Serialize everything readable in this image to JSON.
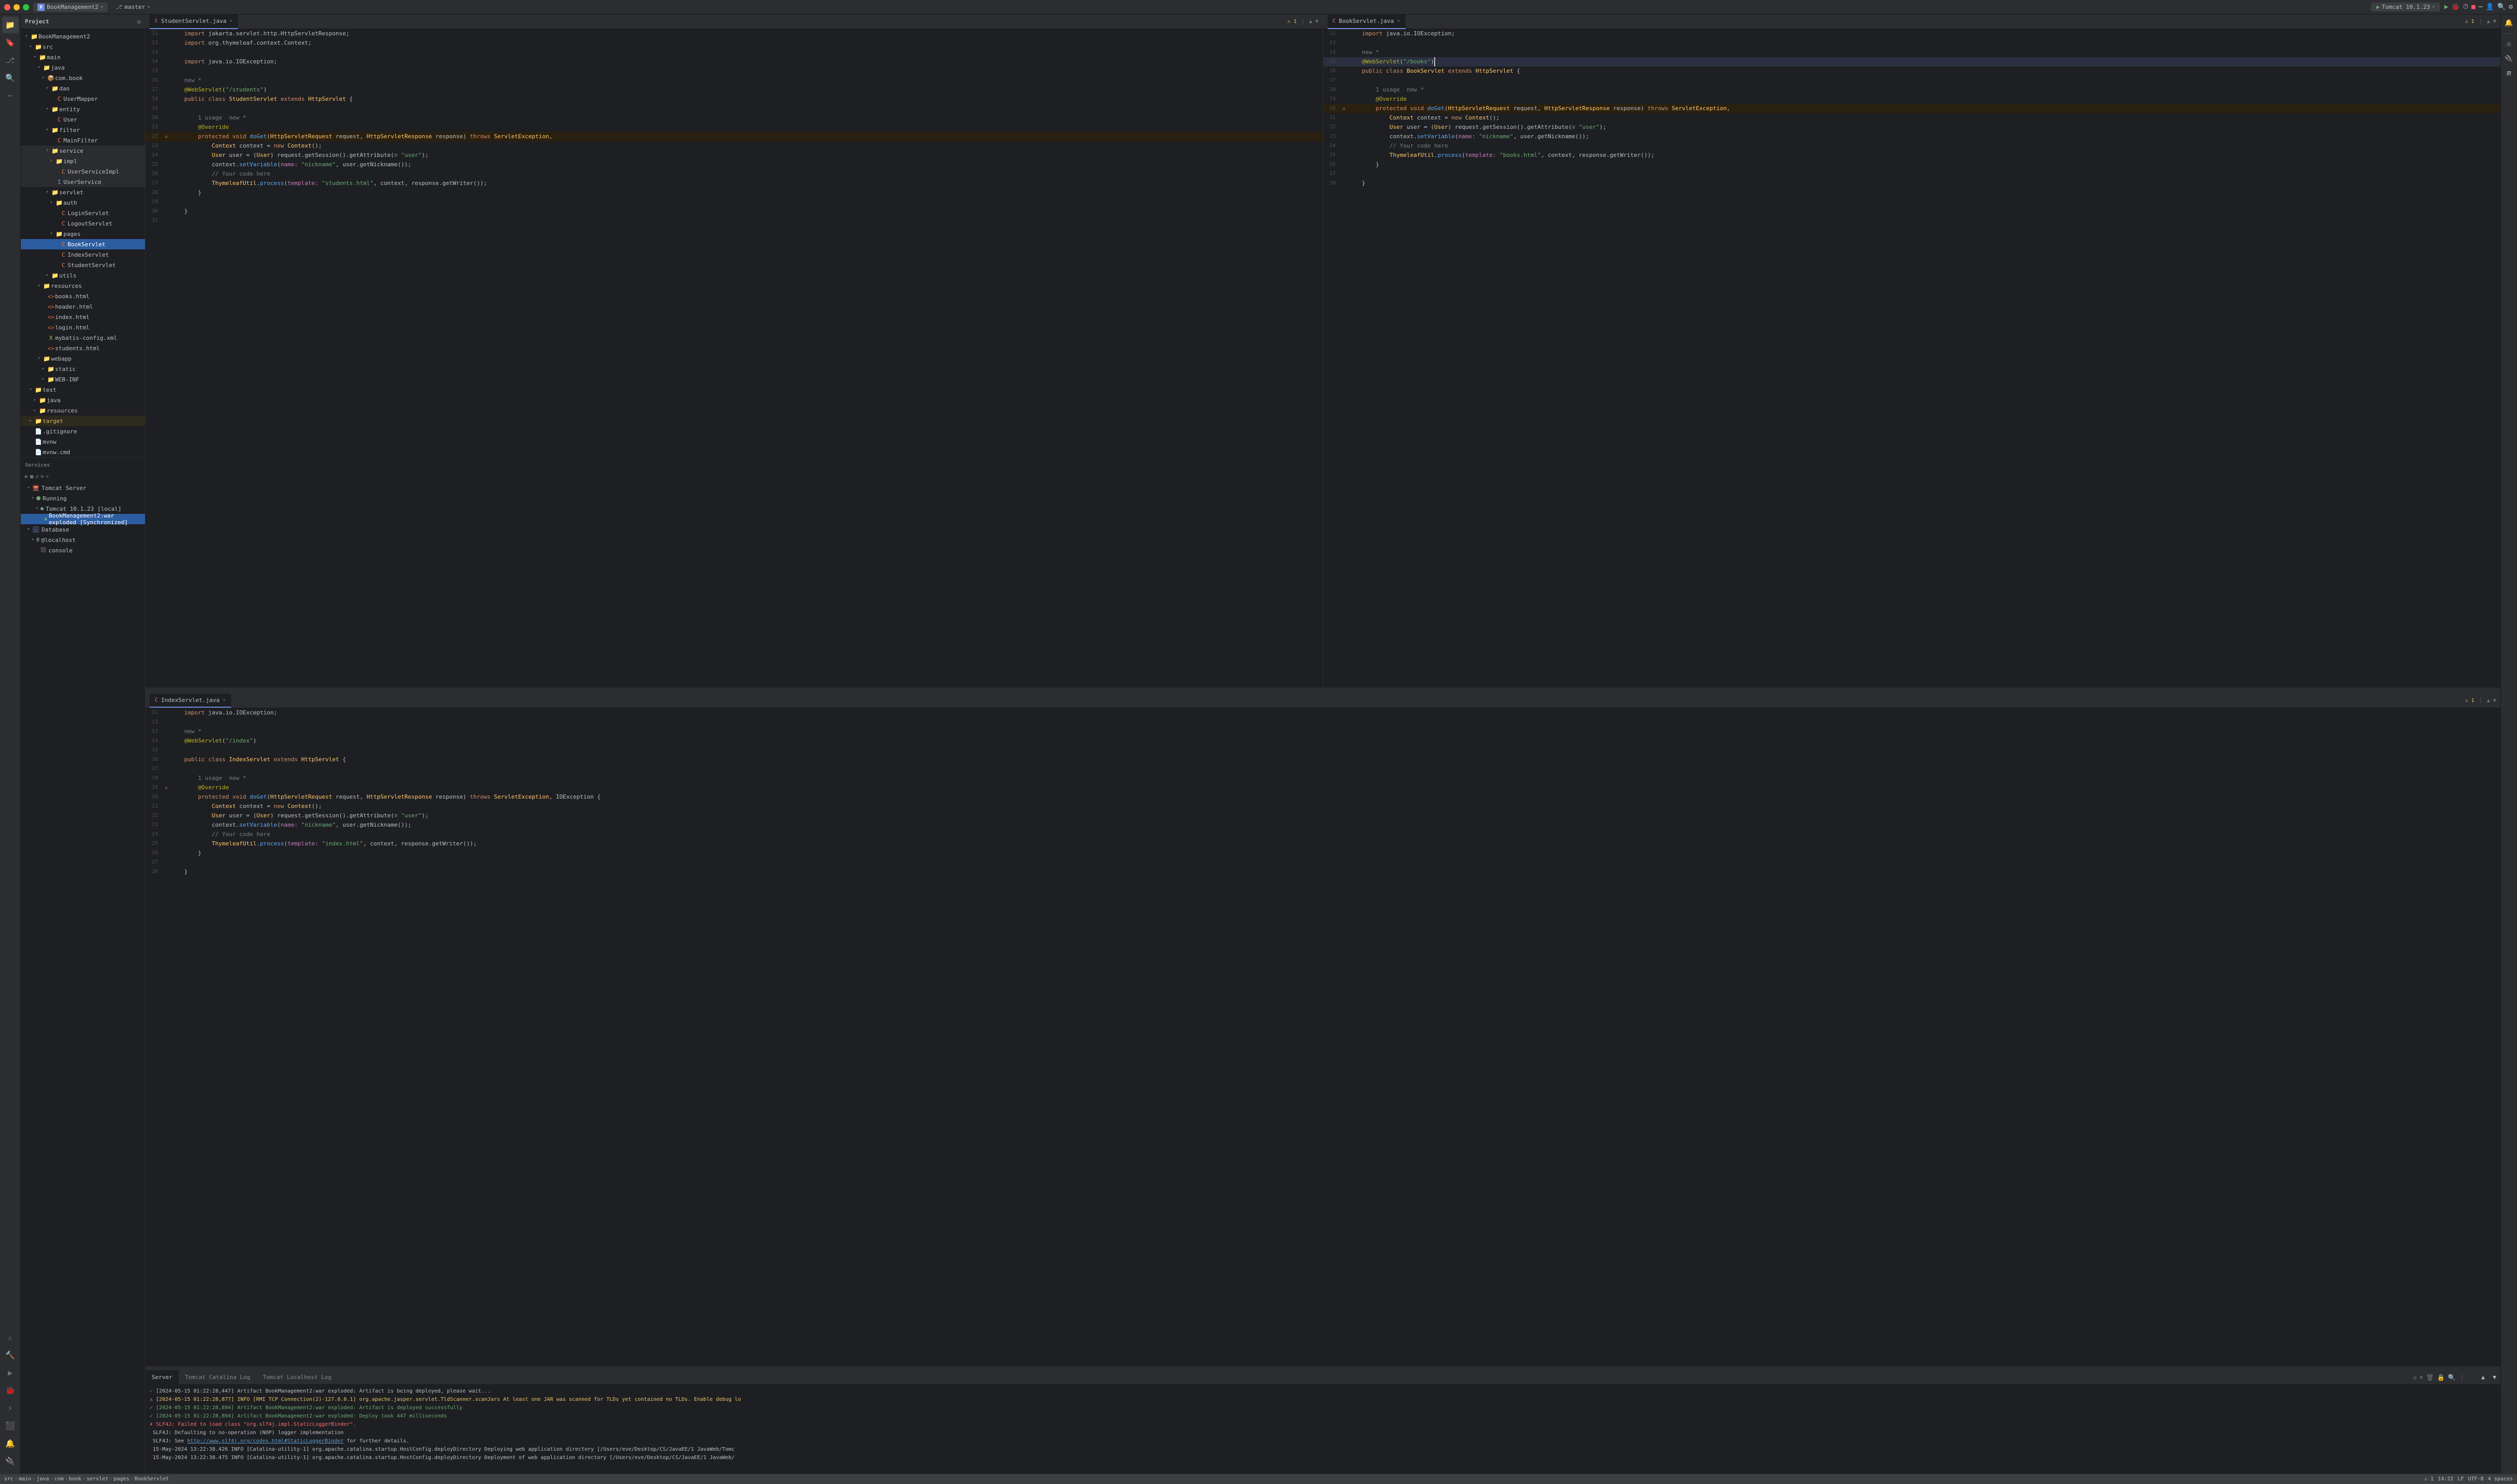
{
  "app": {
    "title": "BookManagement2",
    "branch": "master",
    "run_config": "Tomcat 10.1.23"
  },
  "titlebar": {
    "project_label": "BookManagement2",
    "branch_label": "master",
    "run_label": "Tomcat 10.1.23"
  },
  "panel": {
    "title": "Project"
  },
  "project_tree": {
    "items": [
      {
        "id": "bm2",
        "label": "BookManagement2",
        "type": "root",
        "indent": 0,
        "expanded": true,
        "icon": "folder"
      },
      {
        "id": "src",
        "label": "src",
        "type": "folder",
        "indent": 1,
        "expanded": false,
        "icon": "folder"
      },
      {
        "id": "main",
        "label": "main",
        "type": "folder",
        "indent": 2,
        "expanded": true,
        "icon": "folder"
      },
      {
        "id": "java-main",
        "label": "java",
        "type": "folder",
        "indent": 3,
        "expanded": true,
        "icon": "folder"
      },
      {
        "id": "com-book",
        "label": "com.book",
        "type": "package",
        "indent": 4,
        "expanded": true,
        "icon": "package"
      },
      {
        "id": "dao",
        "label": "dao",
        "type": "folder",
        "indent": 5,
        "expanded": true,
        "icon": "folder"
      },
      {
        "id": "usermapper",
        "label": "UserMapper",
        "type": "java",
        "indent": 6,
        "icon": "java"
      },
      {
        "id": "entity",
        "label": "entity",
        "type": "folder",
        "indent": 5,
        "expanded": true,
        "icon": "folder"
      },
      {
        "id": "user",
        "label": "User",
        "type": "java",
        "indent": 6,
        "icon": "java"
      },
      {
        "id": "filter",
        "label": "filter",
        "type": "folder",
        "indent": 5,
        "expanded": true,
        "icon": "folder"
      },
      {
        "id": "mainfilter",
        "label": "MainFilter",
        "type": "java",
        "indent": 6,
        "icon": "java"
      },
      {
        "id": "service",
        "label": "service",
        "type": "folder",
        "indent": 5,
        "expanded": true,
        "icon": "folder"
      },
      {
        "id": "impl",
        "label": "impl",
        "type": "folder",
        "indent": 6,
        "expanded": true,
        "icon": "folder"
      },
      {
        "id": "userserviceimpl",
        "label": "UserServiceImpl",
        "type": "java",
        "indent": 7,
        "icon": "java"
      },
      {
        "id": "userservice",
        "label": "UserService",
        "type": "java",
        "indent": 6,
        "icon": "java"
      },
      {
        "id": "servlet",
        "label": "servlet",
        "type": "folder",
        "indent": 5,
        "expanded": true,
        "icon": "folder"
      },
      {
        "id": "auth",
        "label": "auth",
        "type": "folder",
        "indent": 6,
        "expanded": true,
        "icon": "folder"
      },
      {
        "id": "loginservlet",
        "label": "LoginServlet",
        "type": "java",
        "indent": 7,
        "icon": "java"
      },
      {
        "id": "logoutservlet",
        "label": "LogoutServlet",
        "type": "java",
        "indent": 7,
        "icon": "java"
      },
      {
        "id": "pages",
        "label": "pages",
        "type": "folder",
        "indent": 6,
        "expanded": true,
        "icon": "folder"
      },
      {
        "id": "bookservlet",
        "label": "BookServlet",
        "type": "java",
        "indent": 7,
        "icon": "java",
        "selected": true
      },
      {
        "id": "indexservlet",
        "label": "IndexServlet",
        "type": "java",
        "indent": 7,
        "icon": "java"
      },
      {
        "id": "studentservlet",
        "label": "StudentServlet",
        "type": "java",
        "indent": 7,
        "icon": "java"
      },
      {
        "id": "utils",
        "label": "utils",
        "type": "folder",
        "indent": 5,
        "expanded": false,
        "icon": "folder"
      },
      {
        "id": "resources",
        "label": "resources",
        "type": "folder",
        "indent": 3,
        "expanded": true,
        "icon": "folder"
      },
      {
        "id": "books-html",
        "label": "books.html",
        "type": "html",
        "indent": 4,
        "icon": "html"
      },
      {
        "id": "header-html",
        "label": "header.html",
        "type": "html",
        "indent": 4,
        "icon": "html"
      },
      {
        "id": "index-html",
        "label": "index.html",
        "type": "html",
        "indent": 4,
        "icon": "html"
      },
      {
        "id": "login-html",
        "label": "login.html",
        "type": "html",
        "indent": 4,
        "icon": "html"
      },
      {
        "id": "mybatis-config",
        "label": "mybatis-config.xml",
        "type": "xml",
        "indent": 4,
        "icon": "xml"
      },
      {
        "id": "students-html",
        "label": "students.html",
        "type": "html",
        "indent": 4,
        "icon": "html"
      },
      {
        "id": "webapp",
        "label": "webapp",
        "type": "folder",
        "indent": 3,
        "expanded": true,
        "icon": "folder"
      },
      {
        "id": "static",
        "label": "static",
        "type": "folder",
        "indent": 4,
        "expanded": false,
        "icon": "folder"
      },
      {
        "id": "web-inf",
        "label": "WEB-INF",
        "type": "folder",
        "indent": 4,
        "expanded": false,
        "icon": "folder"
      },
      {
        "id": "test",
        "label": "test",
        "type": "folder",
        "indent": 1,
        "expanded": true,
        "icon": "folder"
      },
      {
        "id": "java-test",
        "label": "java",
        "type": "folder",
        "indent": 2,
        "expanded": false,
        "icon": "folder"
      },
      {
        "id": "resources-test",
        "label": "resources",
        "type": "folder",
        "indent": 2,
        "expanded": false,
        "icon": "folder"
      },
      {
        "id": "target",
        "label": "target",
        "type": "folder",
        "indent": 1,
        "expanded": false,
        "icon": "folder",
        "highlight": true
      },
      {
        "id": "gitignore",
        "label": ".gitignore",
        "type": "file",
        "indent": 1,
        "icon": "file"
      },
      {
        "id": "mvnw",
        "label": "mvnw",
        "type": "file",
        "indent": 1,
        "icon": "file"
      },
      {
        "id": "mvnw-cmd",
        "label": "mvnw.cmd",
        "type": "file",
        "indent": 1,
        "icon": "file"
      }
    ]
  },
  "services": {
    "header": "Services",
    "items": [
      {
        "id": "tomcat-server",
        "label": "Tomcat Server",
        "type": "server",
        "indent": 0,
        "expanded": true
      },
      {
        "id": "running",
        "label": "Running",
        "type": "status",
        "indent": 1,
        "expanded": true
      },
      {
        "id": "tomcat-local",
        "label": "Tomcat 10.1.23 [local]",
        "type": "instance",
        "indent": 2,
        "expanded": true
      },
      {
        "id": "bm2-war",
        "label": "BookManagement2:war exploded [Synchronized]",
        "type": "artifact",
        "indent": 3
      },
      {
        "id": "database",
        "label": "Database",
        "type": "database",
        "indent": 0,
        "expanded": true
      },
      {
        "id": "localhost",
        "label": "@localhost",
        "type": "db-conn",
        "indent": 1,
        "expanded": false
      },
      {
        "id": "console",
        "label": "console",
        "type": "db-console",
        "indent": 2
      }
    ]
  },
  "editors": {
    "left_pane": {
      "tab_label": "StudentServlet.java",
      "lines": [
        {
          "num": 11,
          "text": "    import jakarta.servlet.http.HttpServletResponse;",
          "gutter": ""
        },
        {
          "num": 12,
          "text": "    import org.thymeleaf.context.Context;",
          "gutter": ""
        },
        {
          "num": 13,
          "text": "",
          "gutter": ""
        },
        {
          "num": 14,
          "text": "    import java.io.IOException;",
          "gutter": ""
        },
        {
          "num": 15,
          "text": "",
          "gutter": ""
        },
        {
          "num": 16,
          "text": "    new *",
          "gutter": ""
        },
        {
          "num": 17,
          "text": "    @WebServlet(\"/students\")",
          "gutter": ""
        },
        {
          "num": 18,
          "text": "    public class StudentServlet extends HttpServlet {",
          "gutter": ""
        },
        {
          "num": 19,
          "text": "",
          "gutter": ""
        },
        {
          "num": 20,
          "text": "        1 usage  new *",
          "gutter": ""
        },
        {
          "num": 21,
          "text": "        @Override",
          "gutter": ""
        },
        {
          "num": 22,
          "text": "        protected void doGet(HttpServletRequest request, HttpServletResponse response) throws ServletException,",
          "gutter": "⚠"
        },
        {
          "num": 23,
          "text": "            Context context = new Context();",
          "gutter": ""
        },
        {
          "num": 24,
          "text": "            User user = (User) request.getSession().getAttribute(\"user\");",
          "gutter": ""
        },
        {
          "num": 25,
          "text": "            context.setVariable(name: \"nickname\", user.getNickname());",
          "gutter": ""
        },
        {
          "num": 26,
          "text": "            // Your code here",
          "gutter": ""
        },
        {
          "num": 27,
          "text": "            ThymeleafUtil.process(template: \"students.html\", context, response.getWriter());",
          "gutter": ""
        },
        {
          "num": 28,
          "text": "        }",
          "gutter": ""
        },
        {
          "num": 29,
          "text": "",
          "gutter": ""
        },
        {
          "num": 30,
          "text": "    }",
          "gutter": ""
        },
        {
          "num": 31,
          "text": "",
          "gutter": ""
        }
      ]
    },
    "right_pane": {
      "tab_label": "BookServlet.java",
      "lines": [
        {
          "num": 12,
          "text": "    import java.io.IOException;",
          "gutter": ""
        },
        {
          "num": 13,
          "text": "",
          "gutter": ""
        },
        {
          "num": 14,
          "text": "    new *",
          "gutter": ""
        },
        {
          "num": 15,
          "text": "    @WebServlet(\"/books\")",
          "gutter": "cursor"
        },
        {
          "num": 16,
          "text": "    public class BookServlet extends HttpServlet {",
          "gutter": ""
        },
        {
          "num": 17,
          "text": "",
          "gutter": ""
        },
        {
          "num": 18,
          "text": "        1 usage  new *",
          "gutter": ""
        },
        {
          "num": 19,
          "text": "        @Override",
          "gutter": ""
        },
        {
          "num": 20,
          "text": "        protected void doGet(HttpServletRequest request, HttpServletResponse response) throws ServletException,",
          "gutter": "⚠"
        },
        {
          "num": 21,
          "text": "            Context context = new Context();",
          "gutter": ""
        },
        {
          "num": 22,
          "text": "            User user = (User) request.getSession().getAttribute(\"user\");",
          "gutter": ""
        },
        {
          "num": 23,
          "text": "            context.setVariable(name: \"nickname\", user.getNickname());",
          "gutter": ""
        },
        {
          "num": 24,
          "text": "            // Your code here",
          "gutter": ""
        },
        {
          "num": 25,
          "text": "            ThymeleafUtil.process(template: \"books.html\", context, response.getWriter());",
          "gutter": ""
        },
        {
          "num": 26,
          "text": "        }",
          "gutter": ""
        },
        {
          "num": 27,
          "text": "",
          "gutter": ""
        },
        {
          "num": 28,
          "text": "    }",
          "gutter": ""
        }
      ]
    },
    "bottom_pane": {
      "tab_label": "IndexServlet.java",
      "lines": [
        {
          "num": 11,
          "text": "    import java.io.IOException;",
          "gutter": ""
        },
        {
          "num": 12,
          "text": "",
          "gutter": ""
        },
        {
          "num": 13,
          "text": "    new *",
          "gutter": ""
        },
        {
          "num": 14,
          "text": "    @WebServlet(\"/index\")",
          "gutter": ""
        },
        {
          "num": 15,
          "text": "",
          "gutter": ""
        },
        {
          "num": 16,
          "text": "    public class IndexServlet extends HttpServlet {",
          "gutter": ""
        },
        {
          "num": 17,
          "text": "",
          "gutter": ""
        },
        {
          "num": 18,
          "text": "        1 usage  new *",
          "gutter": ""
        },
        {
          "num": 19,
          "text": "        @Override",
          "gutter": "⚠"
        },
        {
          "num": 20,
          "text": "        protected void doGet(HttpServletRequest request, HttpServletResponse response) throws ServletException, IOException {",
          "gutter": ""
        },
        {
          "num": 21,
          "text": "            Context context = new Context();",
          "gutter": ""
        },
        {
          "num": 22,
          "text": "            User user = (User) request.getSession().getAttribute(\"user\");",
          "gutter": ""
        },
        {
          "num": 23,
          "text": "            context.setVariable(name: \"nickname\", user.getNickname());",
          "gutter": ""
        },
        {
          "num": 24,
          "text": "            // Your code here",
          "gutter": ""
        },
        {
          "num": 25,
          "text": "            ThymeleafUtil.process(template: \"index.html\", context, response.getWriter());",
          "gutter": ""
        },
        {
          "num": 26,
          "text": "        }",
          "gutter": ""
        },
        {
          "num": 27,
          "text": "",
          "gutter": ""
        },
        {
          "num": 28,
          "text": "    }",
          "gutter": ""
        }
      ]
    }
  },
  "log": {
    "tabs": [
      "Server",
      "Tomcat Catalina Log",
      "Tomcat Localhost Log"
    ],
    "active_tab": "Server",
    "lines": [
      {
        "type": "info",
        "text": "[2024-05-15 01:22:28,447] Artifact BookManagement2:war exploded: Artifact is being deployed, please wait..."
      },
      {
        "type": "warn",
        "text": "[2024-05-15 01:22:28,877] INFO [RMI TCP Connection(2)-127.0.0.1] org.apache.jasper.servlet.TldScanner.scanJars At least one JAR was scanned for TLDs yet contained no TLDs. Enable debug lo"
      },
      {
        "type": "success",
        "text": "[2024-05-15 01:22:28,894] Artifact BookManagement2:war exploded: Artifact is deployed successfully"
      },
      {
        "type": "success",
        "text": "[2024-05-15 01:22:28,894] Artifact BookManagement2:war exploded: Deploy took 447 milliseconds"
      },
      {
        "type": "error",
        "text": "SLF4J: Failed to load class \"org.slf4j.impl.StaticLoggerBinder\"."
      },
      {
        "type": "info",
        "text": "SLF4J: Defaulting to no-operation (NOP) logger implementation"
      },
      {
        "type": "info",
        "text": "SLF4J: See http://www.slf4j.org/codes.html#StaticLoggerBinder for further details."
      },
      {
        "type": "info",
        "text": "15-May-2024 13:22:38.426 INFO [Catalina-utility-1] org.apache.catalina.startup.HostConfig.deployDirectory Deploying web application directory [/Users/eve/Desktop/CS/JavaEE/1 JavaWeb/Tomc"
      },
      {
        "type": "info",
        "text": "15-May-2024 13:22:38.475 INFO [Catalina-utility-1] org.apache.catalina.startup.HostConfig.deployDirectory Deployment of web application directory [/Users/eve/Desktop/CS/JavaEE/1 JavaWeb/"
      }
    ]
  },
  "statusbar": {
    "breadcrumb": [
      "src",
      "main",
      "java",
      "com",
      "book",
      "servlet",
      "pages",
      "BookServlet"
    ],
    "line": "14:22",
    "encoding": "UTF-8",
    "line_ending": "LF",
    "indent": "4 spaces",
    "warnings": "1",
    "errors": "0"
  }
}
